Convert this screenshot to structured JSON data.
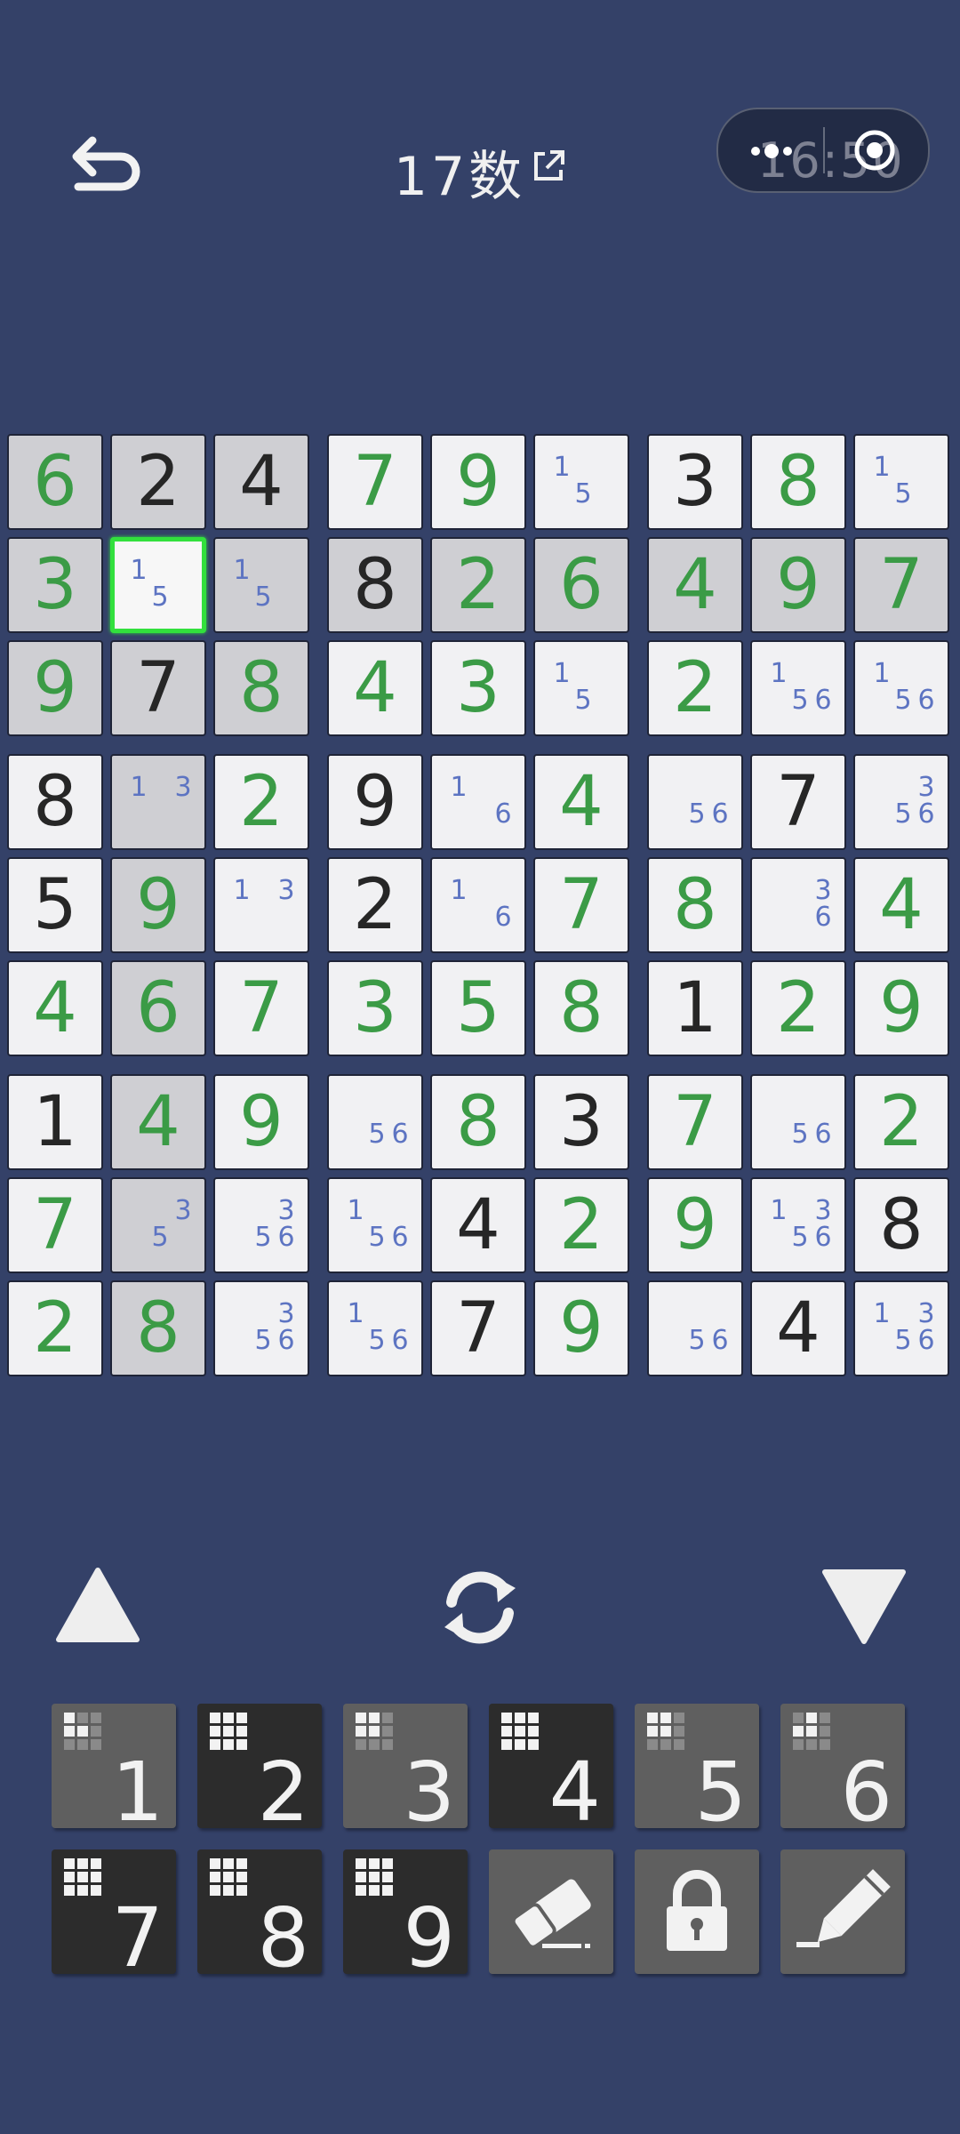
{
  "header": {
    "title": "17数",
    "back_icon": "undo-arrow-icon",
    "external_icon": "external-link-icon"
  },
  "capsule": {
    "time": "16:50",
    "more_icon": "more-dots-icon",
    "close_icon": "target-icon"
  },
  "board": {
    "selected": [
      1,
      1
    ],
    "rows": [
      [
        {
          "v": "6",
          "c": "g",
          "h": 1
        },
        {
          "v": "2",
          "c": "k",
          "h": 1
        },
        {
          "v": "4",
          "c": "k",
          "h": 1
        },
        {
          "v": "7",
          "c": "g"
        },
        {
          "v": "9",
          "c": "g"
        },
        {
          "n": [
            "1",
            "5"
          ]
        },
        {
          "v": "3",
          "c": "k"
        },
        {
          "v": "8",
          "c": "g"
        },
        {
          "n": [
            "1",
            "5"
          ]
        }
      ],
      [
        {
          "v": "3",
          "c": "g",
          "h": 1
        },
        {
          "n": [
            "1",
            "5"
          ],
          "s": 1
        },
        {
          "n": [
            "1",
            "5"
          ],
          "h": 1
        },
        {
          "v": "8",
          "c": "k",
          "h": 1
        },
        {
          "v": "2",
          "c": "g",
          "h": 1
        },
        {
          "v": "6",
          "c": "g",
          "h": 1
        },
        {
          "v": "4",
          "c": "g",
          "h": 1
        },
        {
          "v": "9",
          "c": "g",
          "h": 1
        },
        {
          "v": "7",
          "c": "g",
          "h": 1
        }
      ],
      [
        {
          "v": "9",
          "c": "g",
          "h": 1
        },
        {
          "v": "7",
          "c": "k",
          "h": 1
        },
        {
          "v": "8",
          "c": "g",
          "h": 1
        },
        {
          "v": "4",
          "c": "g"
        },
        {
          "v": "3",
          "c": "g"
        },
        {
          "n": [
            "1",
            "5"
          ]
        },
        {
          "v": "2",
          "c": "g"
        },
        {
          "n": [
            "1",
            "5",
            "6"
          ]
        },
        {
          "n": [
            "1",
            "5",
            "6"
          ]
        }
      ],
      [
        {
          "v": "8",
          "c": "k"
        },
        {
          "n": [
            "1",
            "3"
          ],
          "h": 1
        },
        {
          "v": "2",
          "c": "g"
        },
        {
          "v": "9",
          "c": "k"
        },
        {
          "n": [
            "1",
            "6"
          ]
        },
        {
          "v": "4",
          "c": "g"
        },
        {
          "n": [
            "5",
            "6"
          ]
        },
        {
          "v": "7",
          "c": "k"
        },
        {
          "n": [
            "3",
            "5",
            "6"
          ]
        }
      ],
      [
        {
          "v": "5",
          "c": "k"
        },
        {
          "v": "9",
          "c": "g",
          "h": 1
        },
        {
          "n": [
            "1",
            "3"
          ]
        },
        {
          "v": "2",
          "c": "k"
        },
        {
          "n": [
            "1",
            "6"
          ]
        },
        {
          "v": "7",
          "c": "g"
        },
        {
          "v": "8",
          "c": "g"
        },
        {
          "n": [
            "3",
            "6"
          ]
        },
        {
          "v": "4",
          "c": "g"
        }
      ],
      [
        {
          "v": "4",
          "c": "g"
        },
        {
          "v": "6",
          "c": "g",
          "h": 1
        },
        {
          "v": "7",
          "c": "g"
        },
        {
          "v": "3",
          "c": "g"
        },
        {
          "v": "5",
          "c": "g"
        },
        {
          "v": "8",
          "c": "g"
        },
        {
          "v": "1",
          "c": "k"
        },
        {
          "v": "2",
          "c": "g"
        },
        {
          "v": "9",
          "c": "g"
        }
      ],
      [
        {
          "v": "1",
          "c": "k"
        },
        {
          "v": "4",
          "c": "g",
          "h": 1
        },
        {
          "v": "9",
          "c": "g"
        },
        {
          "n": [
            "5",
            "6"
          ]
        },
        {
          "v": "8",
          "c": "g"
        },
        {
          "v": "3",
          "c": "k"
        },
        {
          "v": "7",
          "c": "g"
        },
        {
          "n": [
            "5",
            "6"
          ]
        },
        {
          "v": "2",
          "c": "g"
        }
      ],
      [
        {
          "v": "7",
          "c": "g"
        },
        {
          "n": [
            "3",
            "5"
          ],
          "h": 1
        },
        {
          "n": [
            "3",
            "5",
            "6"
          ]
        },
        {
          "n": [
            "1",
            "5",
            "6"
          ]
        },
        {
          "v": "4",
          "c": "k"
        },
        {
          "v": "2",
          "c": "g"
        },
        {
          "v": "9",
          "c": "g"
        },
        {
          "n": [
            "1",
            "3",
            "5",
            "6"
          ]
        },
        {
          "v": "8",
          "c": "k"
        }
      ],
      [
        {
          "v": "2",
          "c": "g"
        },
        {
          "v": "8",
          "c": "g",
          "h": 1
        },
        {
          "n": [
            "3",
            "5",
            "6"
          ]
        },
        {
          "n": [
            "1",
            "5",
            "6"
          ]
        },
        {
          "v": "7",
          "c": "k"
        },
        {
          "v": "9",
          "c": "g"
        },
        {
          "n": [
            "5",
            "6"
          ]
        },
        {
          "v": "4",
          "c": "k"
        },
        {
          "n": [
            "1",
            "3",
            "5",
            "6"
          ]
        }
      ]
    ]
  },
  "controls": {
    "up_icon": "triangle-up-icon",
    "refresh_icon": "refresh-icon",
    "down_icon": "triangle-down-icon"
  },
  "keypad": {
    "digits": [
      {
        "label": "1",
        "style": "gray",
        "grid": [
          1,
          0,
          0,
          1,
          1,
          0,
          0,
          0,
          0
        ]
      },
      {
        "label": "2",
        "style": "dark",
        "grid": [
          1,
          1,
          1,
          1,
          1,
          1,
          1,
          1,
          1
        ]
      },
      {
        "label": "3",
        "style": "gray",
        "grid": [
          1,
          1,
          0,
          1,
          1,
          0,
          0,
          0,
          0
        ]
      },
      {
        "label": "4",
        "style": "dark",
        "grid": [
          1,
          1,
          1,
          1,
          1,
          1,
          1,
          1,
          1
        ]
      },
      {
        "label": "5",
        "style": "gray",
        "grid": [
          1,
          1,
          0,
          1,
          1,
          0,
          0,
          0,
          0
        ]
      },
      {
        "label": "6",
        "style": "gray",
        "grid": [
          0,
          1,
          0,
          1,
          1,
          0,
          0,
          0,
          0
        ]
      },
      {
        "label": "7",
        "style": "dark",
        "grid": [
          1,
          1,
          1,
          1,
          1,
          1,
          1,
          1,
          1
        ]
      },
      {
        "label": "8",
        "style": "dark",
        "grid": [
          1,
          1,
          1,
          1,
          1,
          1,
          1,
          1,
          1
        ]
      },
      {
        "label": "9",
        "style": "dark",
        "grid": [
          1,
          1,
          1,
          1,
          1,
          1,
          1,
          1,
          1
        ]
      }
    ],
    "tools": [
      {
        "name": "eraser-icon"
      },
      {
        "name": "lock-icon"
      },
      {
        "name": "pencil-icon"
      }
    ]
  },
  "colors": {
    "background": "#344168",
    "given": "#262626",
    "entered": "#3b9b46",
    "note": "#5d74c2",
    "selection": "#32e03d"
  }
}
